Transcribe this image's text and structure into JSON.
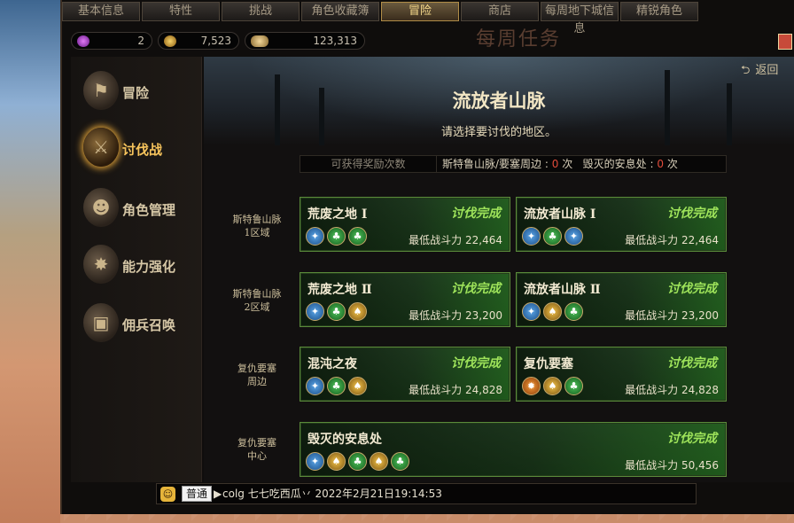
{
  "tabs": [
    "基本信息",
    "特性",
    "挑战",
    "角色收藏簿",
    "冒险",
    "商店",
    "每周地下城信息",
    "精锐角色"
  ],
  "active_tab": "冒险",
  "currency": {
    "gems": "2",
    "gold": "7,523",
    "fatigue": "123,313"
  },
  "background_title": "每周任务",
  "back_label": "返回",
  "sidebar": {
    "items": [
      {
        "label": "冒险",
        "icon": "flag-icon"
      },
      {
        "label": "讨伐战",
        "icon": "crossed-swords-icon"
      },
      {
        "label": "角色管理",
        "icon": "character-icon"
      },
      {
        "label": "能力强化",
        "icon": "burst-icon"
      },
      {
        "label": "佣兵召唤",
        "icon": "chest-icon"
      }
    ],
    "active": "讨伐战"
  },
  "region": {
    "title": "流放者山脉",
    "subtitle": "请选择要讨伐的地区。"
  },
  "reward_bar": {
    "label": "可获得奖励次数",
    "area1": "斯特鲁山脉/要塞周边 :",
    "area1_count": "0",
    "area2": "毁灭的安息处 :",
    "area2_count": "0",
    "unit": "次"
  },
  "row_labels": [
    {
      "line1": "斯特鲁山脉",
      "line2": "1区域"
    },
    {
      "line1": "斯特鲁山脉",
      "line2": "2区域"
    },
    {
      "line1": "复仇要塞",
      "line2": "周边"
    },
    {
      "line1": "复仇要塞",
      "line2": "中心"
    }
  ],
  "power_label": "最低战斗力",
  "dungeons": [
    {
      "name": "荒废之地 Ⅰ",
      "status": "讨伐完成",
      "power": "22,464",
      "chips": [
        "blue",
        "green",
        "green"
      ]
    },
    {
      "name": "流放者山脉 Ⅰ",
      "status": "讨伐完成",
      "power": "22,464",
      "chips": [
        "blue",
        "green",
        "blue"
      ]
    },
    {
      "name": "荒废之地 Ⅱ",
      "status": "讨伐完成",
      "power": "23,200",
      "chips": [
        "blue",
        "green",
        "gold"
      ]
    },
    {
      "name": "流放者山脉 Ⅱ",
      "status": "讨伐完成",
      "power": "23,200",
      "chips": [
        "blue",
        "gold",
        "green"
      ]
    },
    {
      "name": "混沌之夜",
      "status": "讨伐完成",
      "power": "24,828",
      "chips": [
        "blue",
        "green",
        "gold"
      ]
    },
    {
      "name": "复仇要塞",
      "status": "讨伐完成",
      "power": "24,828",
      "chips": [
        "orange",
        "gold",
        "green"
      ]
    },
    {
      "name": "毁灭的安息处",
      "status": "讨伐完成",
      "power": "50,456",
      "chips": [
        "blue",
        "gold",
        "green",
        "gold",
        "green"
      ]
    }
  ],
  "chat": {
    "channel": "普通",
    "message": "colg 七七吃西瓜丷 2022年2月21日19:14:53"
  }
}
